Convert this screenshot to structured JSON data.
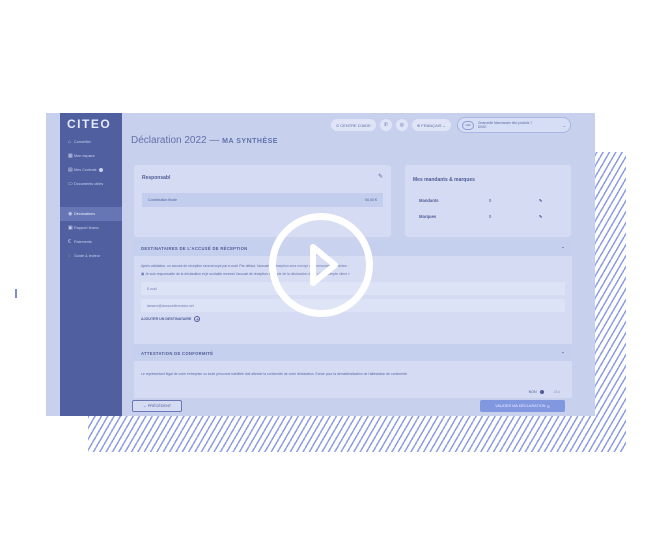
{
  "sidebar": {
    "logo": "CITEO",
    "items": [
      {
        "label": "Conseiller",
        "icon": "home-icon",
        "glyph": "⌂"
      },
      {
        "label": "Mon espace",
        "icon": "grid-icon",
        "glyph": "▦"
      },
      {
        "label": "Mes Contrats",
        "icon": "contract-icon",
        "glyph": "▤",
        "badge": true
      },
      {
        "label": "Documents utiles",
        "icon": "document-icon",
        "glyph": "▭"
      },
      {
        "label": "Déclarations",
        "icon": "declaration-icon",
        "glyph": "◉",
        "active": true
      },
      {
        "label": "Rapport financ.",
        "icon": "report-icon",
        "glyph": "▣"
      },
      {
        "label": "Paiements",
        "icon": "euro-icon",
        "glyph": "€"
      },
      {
        "label": "Guide & lecteur",
        "icon": "help-icon",
        "glyph": "◌"
      }
    ]
  },
  "topbar": {
    "help_center": "CENTRE D'AIDE",
    "language": "FRANÇAIS",
    "user_name": "Gwenaelle Marchandre télé-produits ?",
    "user_org": "DIMO",
    "user_initials": "GM"
  },
  "page": {
    "title": "Déclaration 2022",
    "separator": "—",
    "subtitle": "MA SYNTHÈSE"
  },
  "responsable": {
    "title": "Responsabl",
    "contribution_label": "Contribution finale",
    "contribution_value": "00,00 €"
  },
  "mandants": {
    "title": "Mes mandants & marques",
    "rows": [
      {
        "label": "Mandants",
        "value": "0"
      },
      {
        "label": "Marques",
        "value": "0"
      }
    ]
  },
  "recipients": {
    "title": "DESTINATAIRES DE L'ACCUSÉ DE RÉCEPTION",
    "intro": "Après validation, un accusé de réception sera envoyé par e-mail. Par défaut, l'accusé de réception sera envoyé aux personnes suivantes :",
    "checkbox_text": "Je suis responsable de la déclaration et je souhaite recevoir l'accusé de réception en copie de la déclaration dans « Mon compte client »",
    "email_label": "E-mail",
    "email_value": "lamarre@lanouvelleversion.net",
    "add_label": "AJOUTER UN DESTINATAIRE"
  },
  "conformity": {
    "title": "ATTESTATION DE CONFORMITÉ",
    "text": "Le représentant légal de votre entreprise ou toute personne habilitée doit attester la conformité de votre déclaration. Existe pour la dématérialisation de l'attestation de conformité.",
    "option_no": "NON",
    "option_yes": "OUI"
  },
  "footer": {
    "prev_label": "← PRÉCÉDENT",
    "validate_label": "VALIDER MA DÉCLARATION"
  }
}
